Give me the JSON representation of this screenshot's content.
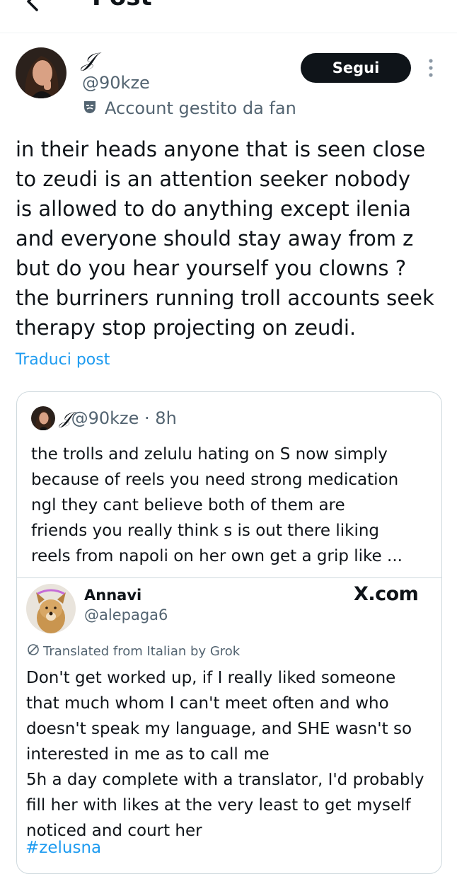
{
  "header": {
    "title": "Post",
    "back_icon": "arrow-left-icon"
  },
  "author": {
    "display_name": "𝒥",
    "handle": "@90kze",
    "badge_label": "Account gestito da fan",
    "badge_icon": "theater-mask-icon",
    "follow_label": "Segui",
    "more_icon": "vertical-ellipsis-icon"
  },
  "post": {
    "text": "in their heads anyone that is seen close\nto zeudi is an attention seeker nobody\nis allowed to do anything except ilenia\nand everyone should stay away from z\nbut do you hear yourself you clowns ?\nthe burriners running troll accounts seek\ntherapy stop projecting on zeudi.",
    "translate_label": "Traduci post"
  },
  "quote": {
    "display_name": "𝒥",
    "handle": "@90kze",
    "separator": "·",
    "time": "8h",
    "text": "the trolls and zelulu hating on S now simply\nbecause of reels you need strong medication\nngl they cant believe both of them are\nfriends you really think s is out there liking\nreels from napoli on her own get a grip like ..."
  },
  "embed": {
    "display_name": "Annavi",
    "handle": "@alepaga6",
    "logo_text": "X.com",
    "translated_label": "Translated from Italian by Grok",
    "translated_icon": "grok-icon",
    "text": "Don't get worked up, if I really liked someone\nthat much whom I can't meet often and who\ndoesn't speak my language, and SHE wasn't so\ninterested in me as to call me\n5h a day complete with a translator, I'd probably\nfill her with likes at the very least to get myself\nnoticed and court her",
    "hashtag": "#zelusna"
  },
  "colors": {
    "accent": "#1d9bf0",
    "text": "#0f1419",
    "muted": "#536471",
    "border": "#cfd9de"
  }
}
